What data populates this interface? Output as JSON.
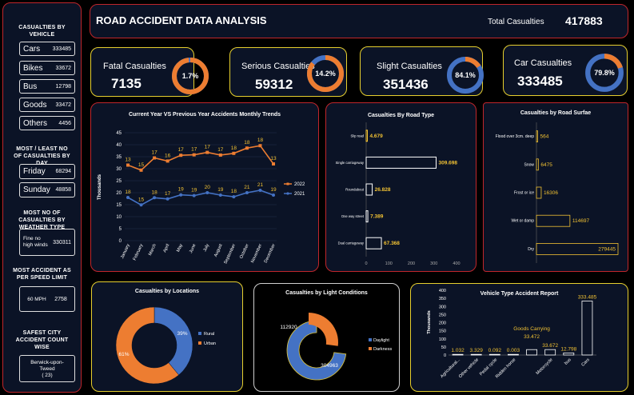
{
  "header": {
    "title": "ROAD ACCIDENT DATA ANALYSIS",
    "total_label": "Total  Casualties",
    "total_value": "417883"
  },
  "sidebar": {
    "vehicle_title": "CASUALTIES BY VEHICLE",
    "vehicles": [
      {
        "label": "Cars",
        "value": "333485"
      },
      {
        "label": "Bikes",
        "value": "33672"
      },
      {
        "label": "Bus",
        "value": "12798"
      },
      {
        "label": "Goods",
        "value": "33472"
      },
      {
        "label": "Others",
        "value": "4456"
      }
    ],
    "day_title": "MOST / LEAST NO OF CASUALTIES BY DAY",
    "days": [
      {
        "label": "Friday",
        "value": "68294"
      },
      {
        "label": "Sunday",
        "value": "48858"
      }
    ],
    "weather_title": "MOST NO OF CASUALTIES BY WEATHER TYPE",
    "weather": {
      "label": "Fine no high winds",
      "value": "330311"
    },
    "speed_title": "MOST ACCIDENT AS PER SPEED LIMIT",
    "speed": {
      "label": "60 MPH",
      "value": "2758"
    },
    "city_title": "SAFEST CITY ACCIDENT COUNT WISE",
    "city": {
      "label": "Berwick-upon-Tweed",
      "value": "( 23)"
    }
  },
  "kpis": [
    {
      "label": "Fatal Casualties",
      "value": "7135",
      "pct_label": "1.7%",
      "pct": 0.017
    },
    {
      "label": "Serious Casualties",
      "value": "59312",
      "pct_label": "14.2%",
      "pct": 0.142
    },
    {
      "label": "Slight Casualties",
      "value": "351436",
      "pct_label": "84.1%",
      "pct": 0.841
    },
    {
      "label": "Car Casualties",
      "value": "333485",
      "pct_label": "79.8%",
      "pct": 0.798
    }
  ],
  "colors": {
    "orange": "#ed7d31",
    "blue": "#4472c4",
    "gold": "#f2c233",
    "panel": "#0b1326"
  },
  "chart_data": [
    {
      "type": "line",
      "title": "Current Year VS Previous Year Accidents Monthly Trends",
      "ylabel": "Thousands",
      "ylim": [
        0,
        45
      ],
      "yticks": [
        "0",
        "5",
        "10",
        "15",
        "20",
        "25",
        "30",
        "35",
        "40",
        "45"
      ],
      "categories": [
        "January",
        "February",
        "March",
        "April",
        "May",
        "June",
        "July",
        "August",
        "September",
        "October",
        "November",
        "December"
      ],
      "series": [
        {
          "name": "2022",
          "values": [
            31.5,
            29.4,
            34.5,
            33.2,
            35.6,
            35.8,
            36.8,
            35.7,
            36.4,
            38.6,
            39.6,
            32
          ],
          "labels": [
            "13",
            "15",
            "17",
            "16",
            "17",
            "17",
            "17",
            "17",
            "18",
            "18",
            "18",
            "13"
          ]
        },
        {
          "name": "2021",
          "values": [
            18,
            14.9,
            17.9,
            17.4,
            19.1,
            18.8,
            20,
            19,
            18.3,
            20,
            21,
            19
          ],
          "labels": [
            "18",
            "15",
            "18",
            "17",
            "19",
            "19",
            "20",
            "19",
            "18",
            "21",
            "21",
            "19"
          ]
        }
      ]
    },
    {
      "type": "bar",
      "orientation": "horizontal",
      "title": "Casualties By Road Type",
      "categories": [
        "Slip road",
        "Single carriageway",
        "Roundabout",
        "One way street",
        "Dual carriageway"
      ],
      "values": [
        4.679,
        309.698,
        26.828,
        7.389,
        67.368
      ],
      "labels": [
        "4.679",
        "309.698",
        "26.828",
        "7.389",
        "67.368"
      ],
      "xlim": [
        0,
        400
      ],
      "xticks": [
        "0",
        "100",
        "200",
        "300",
        "400"
      ]
    },
    {
      "type": "bar",
      "orientation": "horizontal",
      "title": "Casualties by Road Surfae",
      "categories": [
        "Flood over 3cm. deep",
        "Snow",
        "Frost or ice",
        "Wet or damp",
        "Dry"
      ],
      "values": [
        564,
        6475,
        16306,
        114697,
        279445
      ],
      "labels": [
        "564",
        "6475",
        "16306",
        "114697",
        "279445"
      ]
    },
    {
      "type": "pie",
      "title": "Casualties by Locations",
      "categories": [
        "Rural",
        "Urban"
      ],
      "values": [
        39,
        61
      ],
      "labels": [
        "39%",
        "61%"
      ]
    },
    {
      "type": "pie",
      "title": "Casualties by Light Conditions",
      "categories": [
        "Daylight",
        "Darkness"
      ],
      "values": [
        304963,
        112920
      ],
      "labels": [
        "304963",
        "112920"
      ]
    },
    {
      "type": "bar",
      "title": "Vehicle Type Accident Report",
      "ylabel": "Thousands",
      "ylim": [
        0,
        400
      ],
      "yticks": [
        "0",
        "50",
        "100",
        "150",
        "200",
        "250",
        "300",
        "350",
        "400"
      ],
      "categories": [
        "Agricultural...",
        "Other vehicle",
        "Pedal cycle",
        "Ridden horse",
        "Goods Carrying",
        "Motorcycle",
        "Bus",
        "Cars"
      ],
      "values": [
        1.032,
        3.329,
        0.092,
        0.003,
        33.472,
        33.672,
        12.798,
        333.485
      ],
      "labels": [
        "1.032",
        "3.329",
        "0.092",
        "0.003",
        "33.472",
        "33.672",
        "12.798",
        "333.485"
      ],
      "xtick_labels": [
        "Agricultural...",
        "Other vehicle",
        "Pedal cycle",
        "Ridden horse",
        "",
        "Motorcycle",
        "bus",
        "Cars"
      ],
      "annotation": "Goods Carrying"
    }
  ]
}
